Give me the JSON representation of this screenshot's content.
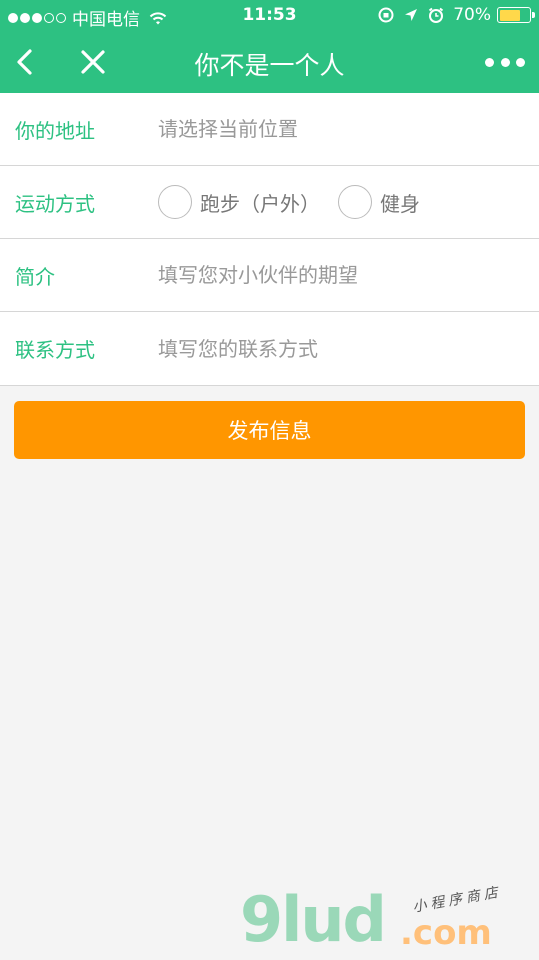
{
  "status_bar": {
    "carrier": "中国电信",
    "time": "11:53",
    "battery": "70%",
    "battery_level": 0.7
  },
  "nav": {
    "title": "你不是一个人",
    "back_icon": "chevron-left-icon",
    "close_icon": "close-icon",
    "more_icon": "more-dots-icon"
  },
  "form": {
    "address": {
      "label": "你的地址",
      "placeholder": "请选择当前位置"
    },
    "sport": {
      "label": "运动方式",
      "options": [
        "跑步（户外）",
        "健身"
      ]
    },
    "intro": {
      "label": "简介",
      "placeholder": "填写您对小伙伴的期望"
    },
    "contact": {
      "label": "联系方式",
      "placeholder": "填写您的联系方式"
    }
  },
  "submit_label": "发布信息",
  "watermark": {
    "logo": "9lud",
    "domain": ".com",
    "tagline": "小程序商店"
  },
  "colors": {
    "brand_green": "#2dc182",
    "submit_orange": "#ff9600",
    "background": "#f4f4f4"
  }
}
